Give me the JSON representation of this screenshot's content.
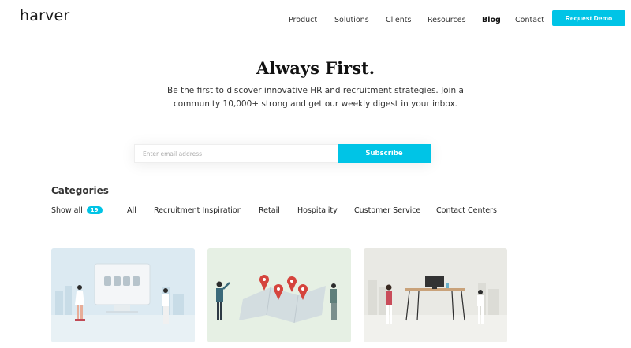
{
  "brand": {
    "logo_text": "harver"
  },
  "nav": {
    "items": [
      "Product",
      "Solutions",
      "Clients",
      "Resources",
      "Blog",
      "Contact"
    ],
    "active": "Blog",
    "cta_label": "Request Demo"
  },
  "hero": {
    "title": "Always First.",
    "description": "Be the first to discover innovative HR and recruitment strategies. Join a community 10,000+ strong and get our weekly digest in your inbox."
  },
  "subscribe": {
    "email_placeholder": "Enter email address",
    "email_value": "",
    "button_label": "Subscribe"
  },
  "categories": {
    "heading": "Categories",
    "show_all_label": "Show all",
    "show_all_count": "19",
    "items": [
      "All",
      "Recruitment Inspiration",
      "Retail",
      "Hospitality",
      "Customer Service",
      "Contact Centers"
    ]
  },
  "cards": [
    {
      "illustration": "video-interview-illustration",
      "bg_color": "#dceaf2"
    },
    {
      "illustration": "map-locations-illustration",
      "bg_color": "#e6f0e4"
    },
    {
      "illustration": "desk-workspace-illustration",
      "bg_color": "#e9e9e4"
    }
  ],
  "colors": {
    "accent": "#00c4e6",
    "text": "#222222"
  }
}
